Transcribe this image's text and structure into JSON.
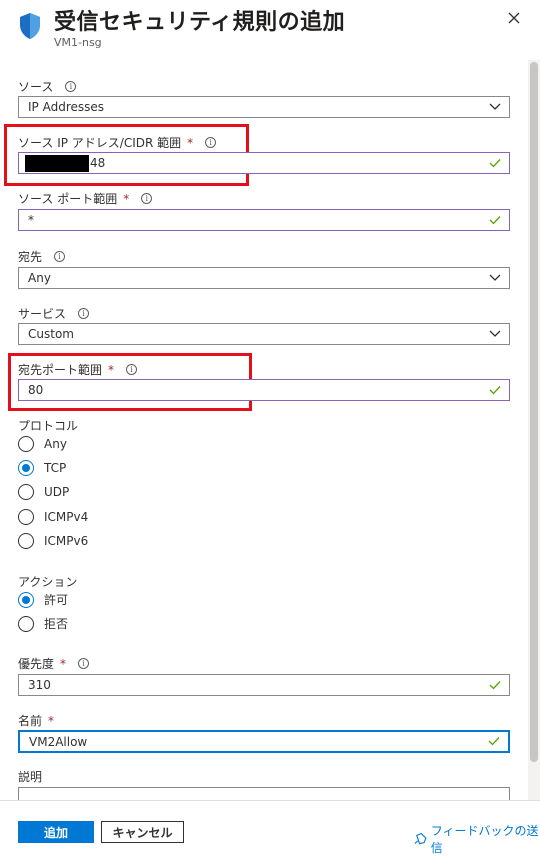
{
  "header": {
    "title": "受信セキュリティ規則の追加",
    "subtitle": "VM1-nsg",
    "icon": "shield-icon",
    "close_icon": "close-icon"
  },
  "form": {
    "source": {
      "label": "ソース",
      "value": "IP Addresses"
    },
    "source_ip": {
      "label": "ソース IP アドレス/CIDR 範囲",
      "value_suffix": "48"
    },
    "source_port": {
      "label": "ソース ポート範囲",
      "value": "*"
    },
    "destination": {
      "label": "宛先",
      "value": "Any"
    },
    "service": {
      "label": "サービス",
      "value": "Custom"
    },
    "dest_port": {
      "label": "宛先ポート範囲",
      "value": "80"
    },
    "protocol": {
      "label": "プロトコル",
      "options": [
        "Any",
        "TCP",
        "UDP",
        "ICMPv4",
        "ICMPv6"
      ],
      "selected": "TCP"
    },
    "action": {
      "label": "アクション",
      "options": [
        "許可",
        "拒否"
      ],
      "selected": "許可"
    },
    "priority": {
      "label": "優先度",
      "value": "310"
    },
    "name": {
      "label": "名前",
      "value": "VM2Allow"
    },
    "description": {
      "label": "説明"
    }
  },
  "footer": {
    "add_label": "追加",
    "cancel_label": "キャンセル",
    "feedback_label": "フィードバックの送信"
  },
  "colors": {
    "accent": "#0078d4",
    "required": "#a4262c",
    "valid_border": "#8764b8",
    "check": "#57a300",
    "highlight": "#e3101a"
  }
}
